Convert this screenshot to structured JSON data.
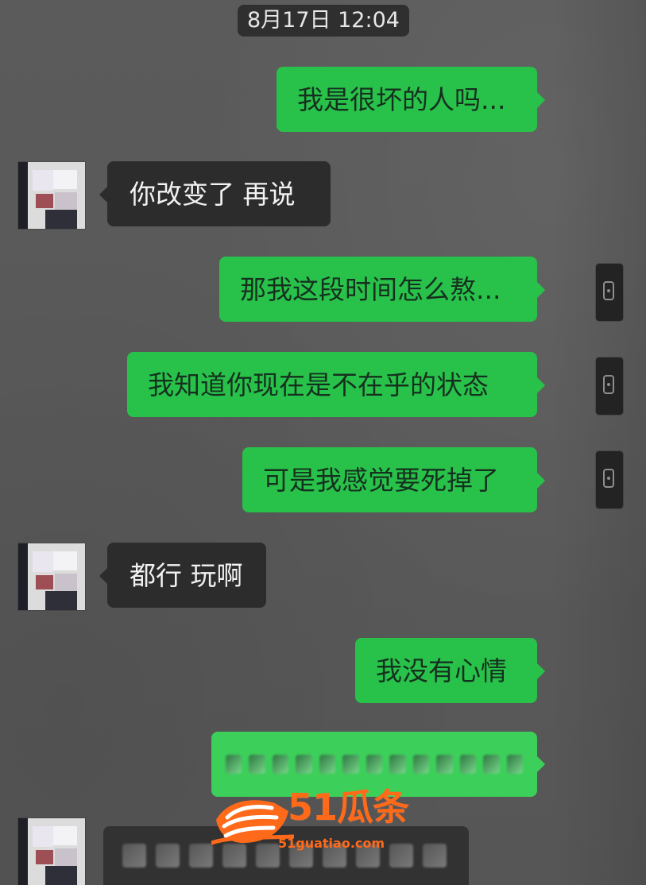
{
  "timestamp": "8月17日 12:04",
  "messages": [
    {
      "direction": "sent",
      "text": "我是很坏的人吗..."
    },
    {
      "direction": "received",
      "text": "你改变了 再说"
    },
    {
      "direction": "sent",
      "text": "那我这段时间怎么熬..."
    },
    {
      "direction": "sent",
      "text": "我知道你现在是不在乎的状态"
    },
    {
      "direction": "sent",
      "text": "可是我感觉要死掉了"
    },
    {
      "direction": "received",
      "text": "都行 玩啊"
    },
    {
      "direction": "sent",
      "text": "我没有心情"
    }
  ],
  "watermark": {
    "brand": "51瓜条",
    "domain": "51guatiao.com"
  },
  "colors": {
    "background": "#5a5a5a",
    "sent_bubble": "#28c24a",
    "received_bubble": "#2c2c2c",
    "watermark": "#ff6a1a"
  }
}
